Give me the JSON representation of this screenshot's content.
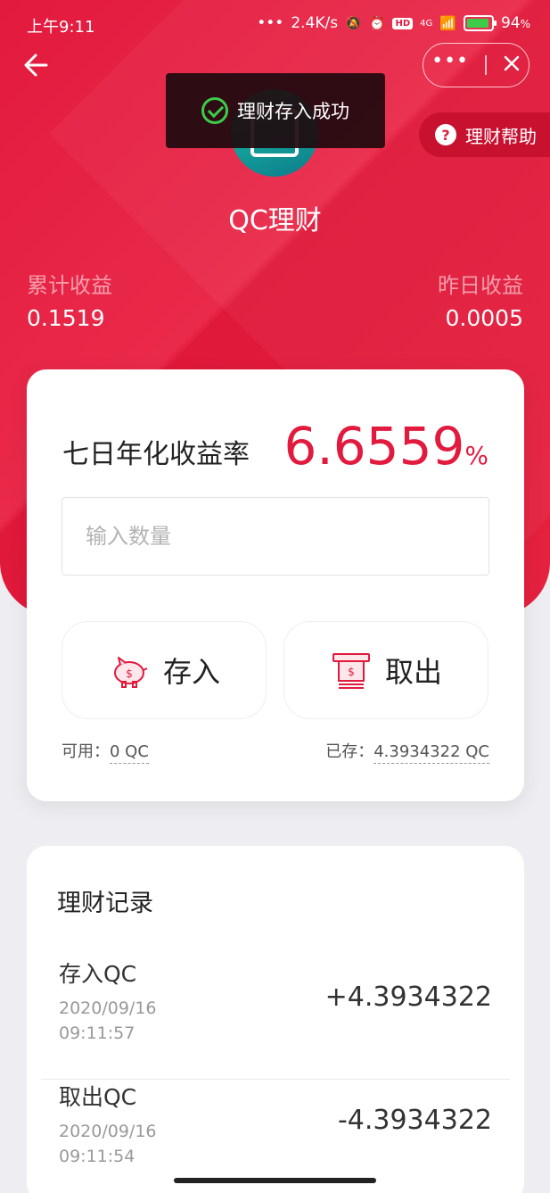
{
  "status_bar": {
    "time": "上午9:11",
    "speed": "2.4K/s",
    "battery": "94",
    "battery_unit": "%",
    "hd": "HD",
    "net": "4G"
  },
  "toast": {
    "text": "理财存入成功"
  },
  "help": {
    "label": "理财帮助"
  },
  "header": {
    "title": "QC理财"
  },
  "earnings": {
    "total_label": "累计收益",
    "total_value": "0.1519",
    "yesterday_label": "昨日收益",
    "yesterday_value": "0.0005"
  },
  "card": {
    "rate_label": "七日年化收益率",
    "rate_value": "6.6559",
    "rate_unit": "%",
    "input_placeholder": "输入数量",
    "deposit_label": "存入",
    "withdraw_label": "取出",
    "available_label": "可用：",
    "available_value": "0 QC",
    "saved_label": "已存：",
    "saved_value": "4.3934322 QC"
  },
  "records": {
    "title": "理财记录",
    "items": [
      {
        "type": "存入QC",
        "date": "2020/09/16",
        "time": "09:11:57",
        "amount": "+4.3934322"
      },
      {
        "type": "取出QC",
        "date": "2020/09/16",
        "time": "09:11:54",
        "amount": "-4.3934322"
      }
    ]
  },
  "colors": {
    "primary": "#e21a3e",
    "success": "#3ccc4a"
  }
}
